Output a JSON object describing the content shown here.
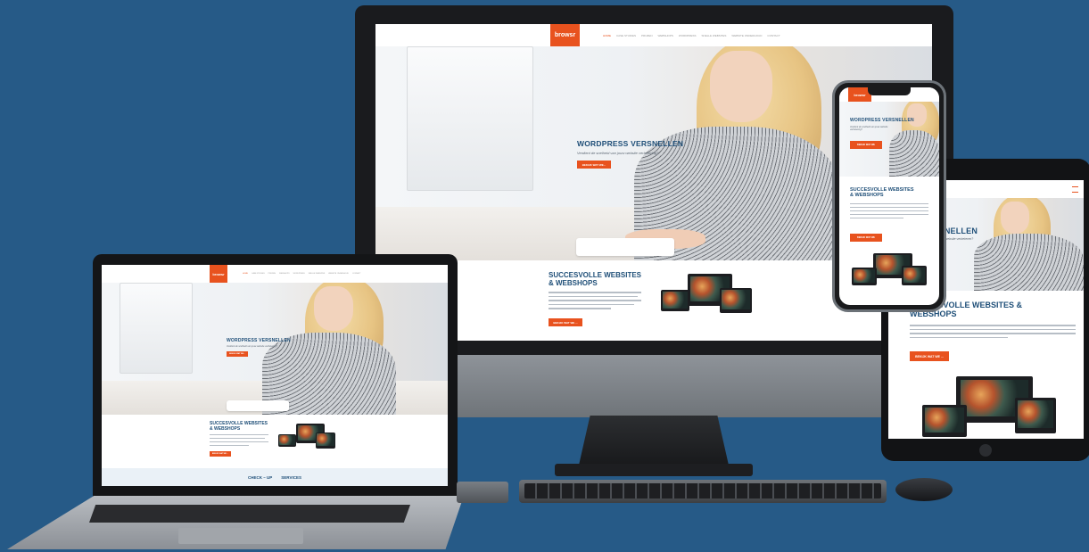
{
  "brand": {
    "logo": "browsr",
    "accent": "#e8521e",
    "navy": "#1f4f78",
    "background": "#265a87"
  },
  "nav": {
    "items": [
      "HOME",
      "CASE STUDIES",
      "PRIJZEN",
      "WEBSHOPS",
      "WORDPRESS",
      "SNELLE WEBSITES",
      "WEBSITE ONDERHOUD",
      "CONTACT"
    ]
  },
  "hero": {
    "title": "WORDPRESS VERSNELLEN",
    "subtitle": "Verdient de snelheid van jouw website verbetering?",
    "cta": "BEKIJK WAT WE..."
  },
  "section": {
    "title_line1": "SUCCESVOLLE WEBSITES",
    "title_line2": "& WEBSHOPS",
    "cta": "BEKIJK WAT WE ..."
  },
  "laptop": {
    "bottom_strip": {
      "left": "CHECK – UP",
      "right": "SERVICES"
    }
  },
  "tablet": {
    "hero_title": "WORDPRESS VERSNELLEN",
    "hero_sub": "de snelheid van jouw website verbeteren?",
    "hero_cta": "KIJK DE...",
    "section_title_line1": "SUCCESVOLLE WEBSITES &",
    "section_title_line2": "WEBSHOPS",
    "section_cta": "BEKIJK WAT WE ..."
  },
  "phone": {
    "hero_title": "WORDPRESS VERSNELLEN",
    "hero_sub": "Verdient de snelheid van jouw website verbetering?",
    "hero_cta": "BEKIJK WAT WE",
    "section_title_line1": "SUCCESVOLLE WEBSITES",
    "section_title_line2": "& WEBSHOPS",
    "section_cta": "BEKIJK WAT WE"
  }
}
